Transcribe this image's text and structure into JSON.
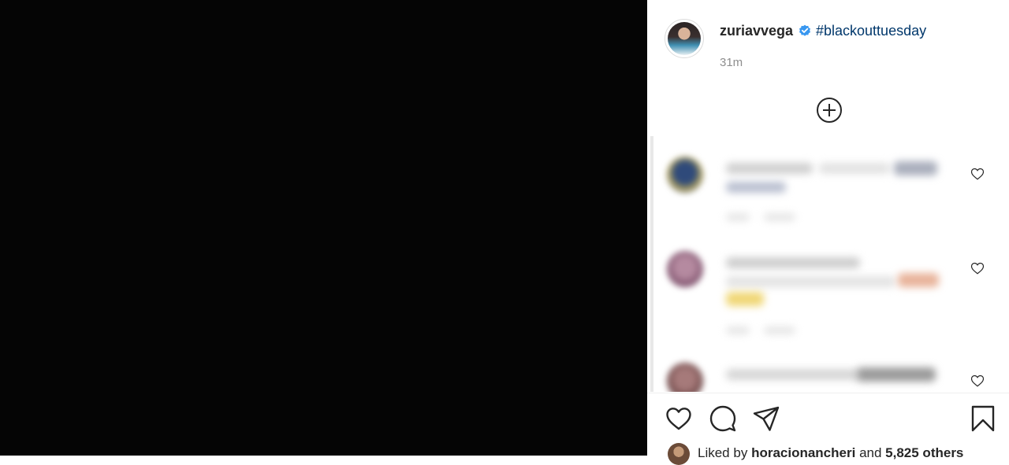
{
  "post": {
    "username": "zuriavvega",
    "caption_hashtag": "#blackouttuesday",
    "timestamp": "31m",
    "verified": true
  },
  "icons": {
    "verified": "verified-badge-icon",
    "load_more": "plus-circle-icon",
    "like": "heart-icon",
    "comment": "comment-icon",
    "share": "paper-plane-icon",
    "save": "bookmark-icon"
  },
  "colors": {
    "text": "#262626",
    "hashtag": "#00376b",
    "muted": "#8e8e8e",
    "verified": "#3897f0",
    "media_bg": "#050505"
  },
  "likes": {
    "prefix": "Liked by",
    "user": "horacionancheri",
    "conjunction": "and",
    "others": "5,825 others"
  }
}
